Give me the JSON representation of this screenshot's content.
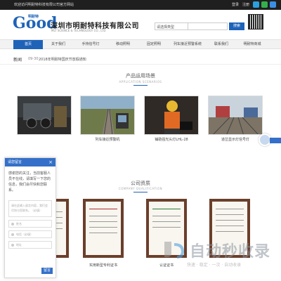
{
  "topbar": {
    "welcome": "欢迎访问明耐特科技有限公司官方网站",
    "login": "登录",
    "register": "注册"
  },
  "header": {
    "logo_letter": "Good",
    "logo_sub": "明耐特",
    "company_cn": "深圳市明耐特科技有限公司",
    "company_en": "MLT SCIENCE & TECHNOLOGY CO., LTD",
    "search_type": "请选择类型",
    "search_button": "搜索"
  },
  "nav": {
    "items": [
      "首页",
      "关于我们",
      "手持信号灯",
      "移动照明",
      "固定照明",
      "列车接近预警系统",
      "联系我们",
      "明耐特商城"
    ]
  },
  "news": {
    "label": "新闻",
    "date": "09-30",
    "text": "2018年明耐特国庆节放假通知"
  },
  "scenarios": {
    "title": "产品运用场景",
    "subtitle": "APPLICATION SCENARIOS",
    "items": [
      {
        "caption": ""
      },
      {
        "caption": "列车接近预警机"
      },
      {
        "caption": "铺助强光头灯LHL-28"
      },
      {
        "caption": "道岔显示灯信号灯"
      }
    ]
  },
  "qualification": {
    "title": "公司资质",
    "subtitle": "COMPANY QUALIFICATION",
    "items": [
      {
        "caption": ""
      },
      {
        "caption": "实用新型专利证书"
      },
      {
        "caption": "认证证书"
      },
      {
        "caption": ""
      }
    ]
  },
  "chat": {
    "title": "请您留言",
    "close": "×",
    "message": "感谢您的关注，当前客服人员不在线，请填写一下您的信息，我们会尽快和您联系。",
    "textarea_placeholder": "请在此输入留言内容，我们会尽快与您联系。（必填）",
    "name_placeholder": "姓名",
    "phone_placeholder": "电话（必填）",
    "address_placeholder": "地址",
    "send": "留言"
  },
  "watermark": {
    "text": "自动秒收录",
    "sub": "快速 · 稳定 · 一次 · 自动收录"
  },
  "colors": {
    "brand": "#1e63b8",
    "chat_header": "#3470c9",
    "topbar": "#1f1f1f"
  }
}
